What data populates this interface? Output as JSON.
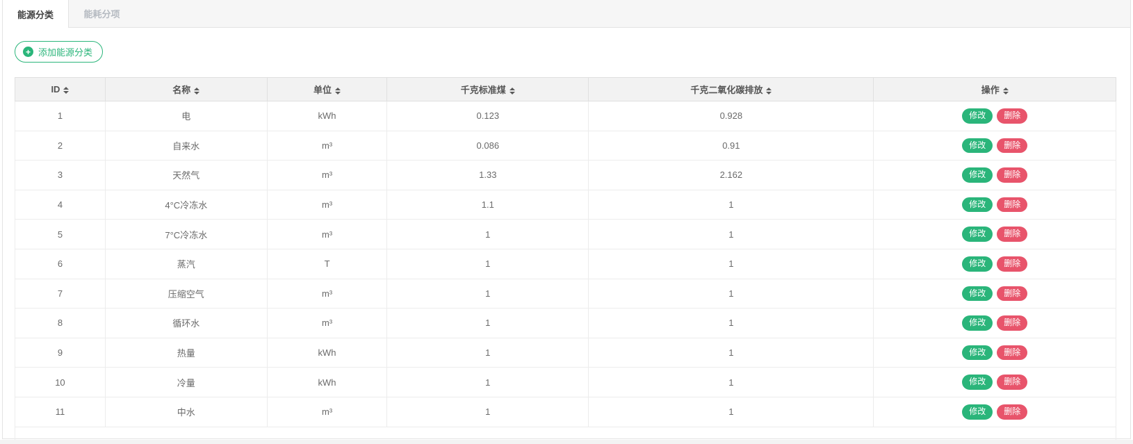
{
  "colors": {
    "green": "#2ab57a",
    "red": "#e8546b"
  },
  "tabs": [
    {
      "label": "能源分类",
      "active": true
    },
    {
      "label": "能耗分项",
      "active": false
    }
  ],
  "toolbar": {
    "add_button_label": "添加能源分类",
    "plus_icon": "+"
  },
  "table": {
    "columns": [
      {
        "key": "id",
        "label": "ID"
      },
      {
        "key": "name",
        "label": "名称"
      },
      {
        "key": "unit",
        "label": "单位"
      },
      {
        "key": "coal",
        "label": "千克标准煤"
      },
      {
        "key": "co2",
        "label": "千克二氧化碳排放"
      },
      {
        "key": "ops",
        "label": "操作"
      }
    ],
    "rows": [
      {
        "id": "1",
        "name": "电",
        "unit": "kWh",
        "coal": "0.123",
        "co2": "0.928"
      },
      {
        "id": "2",
        "name": "自来水",
        "unit": "m³",
        "coal": "0.086",
        "co2": "0.91"
      },
      {
        "id": "3",
        "name": "天然气",
        "unit": "m³",
        "coal": "1.33",
        "co2": "2.162"
      },
      {
        "id": "4",
        "name": "4°C冷冻水",
        "unit": "m³",
        "coal": "1.1",
        "co2": "1"
      },
      {
        "id": "5",
        "name": "7°C冷冻水",
        "unit": "m³",
        "coal": "1",
        "co2": "1"
      },
      {
        "id": "6",
        "name": "蒸汽",
        "unit": "T",
        "coal": "1",
        "co2": "1"
      },
      {
        "id": "7",
        "name": "压缩空气",
        "unit": "m³",
        "coal": "1",
        "co2": "1"
      },
      {
        "id": "8",
        "name": "循环水",
        "unit": "m³",
        "coal": "1",
        "co2": "1"
      },
      {
        "id": "9",
        "name": "热量",
        "unit": "kWh",
        "coal": "1",
        "co2": "1"
      },
      {
        "id": "10",
        "name": "冷量",
        "unit": "kWh",
        "coal": "1",
        "co2": "1"
      },
      {
        "id": "11",
        "name": "中水",
        "unit": "m³",
        "coal": "1",
        "co2": "1"
      }
    ],
    "actions": {
      "edit": "修改",
      "delete": "删除"
    }
  }
}
